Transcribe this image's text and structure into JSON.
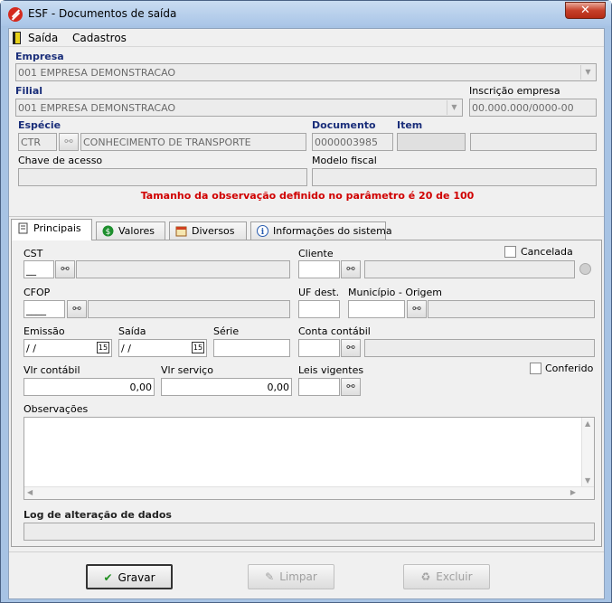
{
  "window": {
    "title": "ESF - Documentos de saída",
    "close": "✕"
  },
  "menu": {
    "items": [
      {
        "label": "Saída"
      },
      {
        "label": "Cadastros"
      }
    ]
  },
  "header": {
    "empresa_label": "Empresa",
    "empresa_value": "001 EMPRESA DEMONSTRACAO",
    "filial_label": "Filial",
    "filial_value": "001 EMPRESA DEMONSTRACAO",
    "inscricao_label": "Inscrição empresa",
    "inscricao_value": "00.000.000/0000-00",
    "especie_label": "Espécie",
    "especie_code": "CTR",
    "especie_desc": "CONHECIMENTO DE TRANSPORTE",
    "documento_label": "Documento",
    "documento_value": "0000003985",
    "item_label": "Item",
    "item_value": "",
    "chave_label": "Chave de acesso",
    "chave_value": "",
    "modelo_label": "Modelo fiscal",
    "modelo_value": "",
    "warning": "Tamanho da observação definido no parâmetro é 20 de 100"
  },
  "tabs": [
    {
      "label": "Principais"
    },
    {
      "label": "Valores"
    },
    {
      "label": "Diversos"
    },
    {
      "label": "Informações do sistema"
    }
  ],
  "principais": {
    "cst_label": "CST",
    "cst_value": "__",
    "cliente_label": "Cliente",
    "cliente_value": "",
    "cancelada_label": "Cancelada",
    "cfop_label": "CFOP",
    "cfop_value": "____",
    "uf_label": "UF dest.",
    "uf_value": "",
    "municipio_label": "Município - Origem",
    "municipio_value": "",
    "emissao_label": "Emissão",
    "emissao_value": " / /",
    "saida_label": "Saída",
    "saida_value": " / /",
    "serie_label": "Série",
    "serie_value": "",
    "conta_label": "Conta contábil",
    "conta_value": "",
    "vlr_contabil_label": "Vlr contábil",
    "vlr_contabil_value": "0,00",
    "vlr_servico_label": "Vlr serviço",
    "vlr_servico_value": "0,00",
    "leis_label": "Leis vigentes",
    "leis_value": "",
    "conferido_label": "Conferido",
    "obs_label": "Observações",
    "obs_value": "",
    "log_label": "Log de alteração de dados",
    "log_value": ""
  },
  "buttons": {
    "gravar": "Gravar",
    "limpar": "Limpar",
    "excluir": "Excluir"
  },
  "colors": {
    "warning": "#d00000",
    "label_blue": "#1a2e7a",
    "title_bar": "#a9c5e7",
    "close": "#c7412b"
  }
}
